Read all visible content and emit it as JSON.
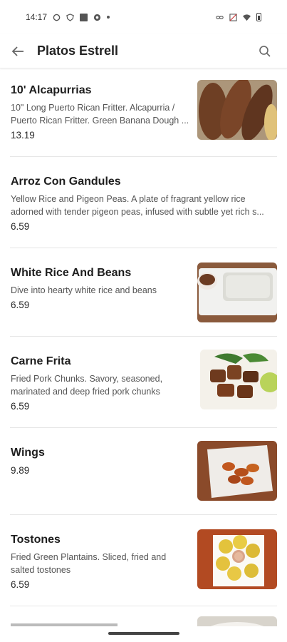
{
  "status": {
    "time": "14:17"
  },
  "app_bar": {
    "title": "Platos Estrell"
  },
  "items": [
    {
      "name": "10' Alcapurrias",
      "description": "10\" Long Puerto Rican Fritter. Alcapurria / Puerto Rican Fritter. Green Banana Dough ...",
      "price": "13.19"
    },
    {
      "name": "Arroz Con Gandules",
      "description": "Yellow Rice and Pigeon Peas. A plate of fragrant yellow rice adorned with tender pigeon peas, infused with subtle yet rich s...",
      "price": "6.59"
    },
    {
      "name": "White Rice And Beans",
      "description": "Dive into hearty white rice and beans",
      "price": "6.59"
    },
    {
      "name": "Carne Frita",
      "description": "Fried Pork Chunks. Savory, seasoned, marinated and deep fried pork chunks",
      "price": "6.59"
    },
    {
      "name": "Wings",
      "description": "",
      "price": "9.89"
    },
    {
      "name": "Tostones",
      "description": "Fried Green Plantains. Sliced, fried and salted tostones",
      "price": "6.59"
    }
  ]
}
